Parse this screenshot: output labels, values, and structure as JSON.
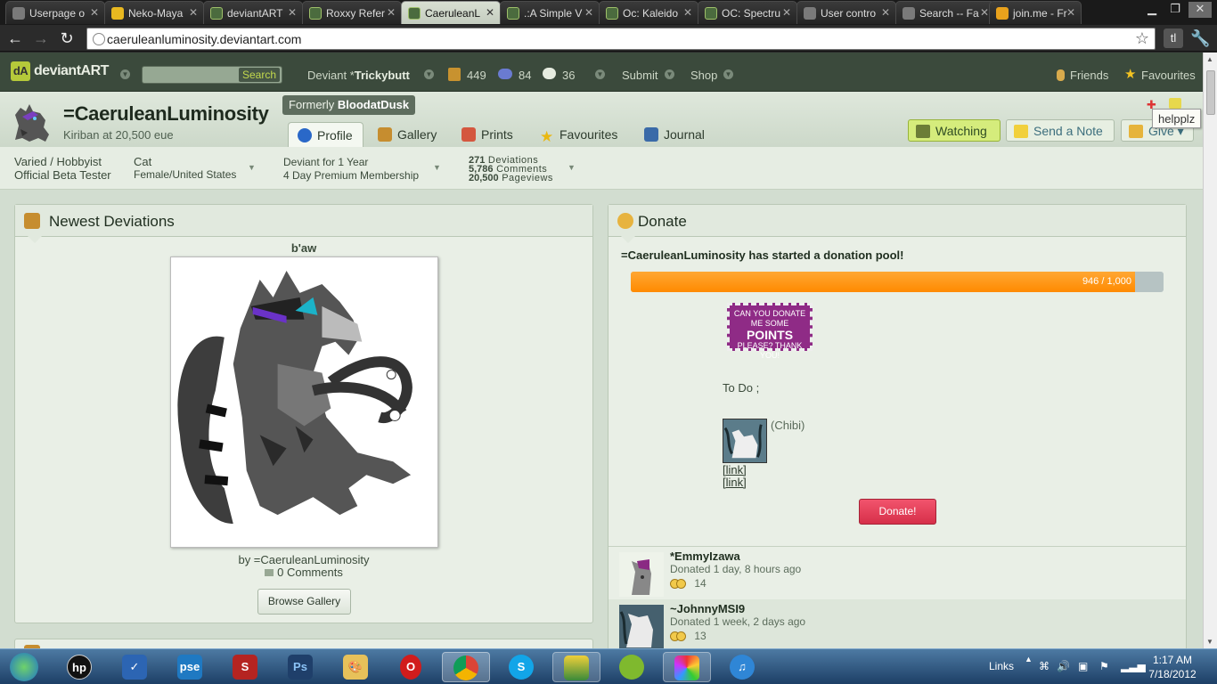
{
  "browser": {
    "tabs": [
      {
        "title": "Userpage o",
        "fav": "paw"
      },
      {
        "title": "Neko-Maya",
        "fav": "star"
      },
      {
        "title": "deviantART",
        "fav": "da"
      },
      {
        "title": "Roxxy Refer",
        "fav": "da"
      },
      {
        "title": "CaeruleanL",
        "fav": "da",
        "active": true
      },
      {
        "title": ".:A Simple V",
        "fav": "da"
      },
      {
        "title": "Oc: Kaleido",
        "fav": "da"
      },
      {
        "title": "OC: Spectru",
        "fav": "da"
      },
      {
        "title": "User contro",
        "fav": "paw"
      },
      {
        "title": "Search -- Fa",
        "fav": "paw"
      },
      {
        "title": "join.me - Fr",
        "fav": "join"
      }
    ],
    "url": "caeruleanluminosity.deviantart.com"
  },
  "da_nav": {
    "logo": "deviantART",
    "search_label": "Search",
    "deviant_prefix": "Deviant",
    "user_symbol": "*",
    "username": "Trickybutt",
    "stat_messages": "449",
    "stat_watch": "84",
    "stat_notes": "36",
    "submit": "Submit",
    "shop": "Shop",
    "friends": "Friends",
    "favourites": "Favourites"
  },
  "profile": {
    "symbol": "=",
    "name": "CaeruleanLuminosity",
    "tagline": "Kiriban at 20,500 eue",
    "formerly_prefix": "Formerly",
    "formerly_name": "BloodatDusk",
    "tabs": [
      "Profile",
      "Gallery",
      "Prints",
      "Favourites",
      "Journal"
    ],
    "watching": "Watching",
    "send_note": "Send a Note",
    "give": "Give",
    "tooltip": "helpplz"
  },
  "info": {
    "type1": "Varied / Hobbyist",
    "type2": "Official Beta Tester",
    "species": "Cat",
    "location": "Female/United States",
    "deviant_for": "Deviant for 1 Year",
    "premium": "4 Day Premium Membership",
    "deviations_n": "271",
    "deviations_l": "Deviations",
    "comments_n": "5,786",
    "comments_l": "Comments",
    "pageviews_n": "20,500",
    "pageviews_l": "Pageviews"
  },
  "newest": {
    "heading": "Newest Deviations",
    "art_title": "b'aw",
    "by": "by =CaeruleanLuminosity",
    "comments": "0 Comments",
    "browse": "Browse Gallery"
  },
  "donate": {
    "heading": "Donate",
    "started": "=CaeruleanLuminosity has started a donation pool!",
    "progress": 946,
    "goal": 1000,
    "progress_text": "946 / 1,000",
    "stamp_line1": "CAN YOU DONATE",
    "stamp_line2": "ME SOME",
    "stamp_big": "POINTS",
    "stamp_line3": "PLEASE? THANK YOU!",
    "todo": "To Do ;",
    "chibi": "(Chibi)",
    "link1": "[link]",
    "link2": "[link]",
    "button": "Donate!",
    "donors": [
      {
        "name": "*EmmyIzawa",
        "when": "Donated 1 day, 8 hours ago",
        "points": "14"
      },
      {
        "name": "~JohnnyMSI9",
        "when": "Donated 1 week, 2 days ago",
        "points": "13"
      }
    ]
  },
  "taskbar": {
    "links": "Links",
    "time": "1:17 AM",
    "date": "7/18/2012"
  },
  "colors": {
    "accent": "#b5c93a",
    "bar": "#ff8a00",
    "donate": "#e0384f"
  }
}
